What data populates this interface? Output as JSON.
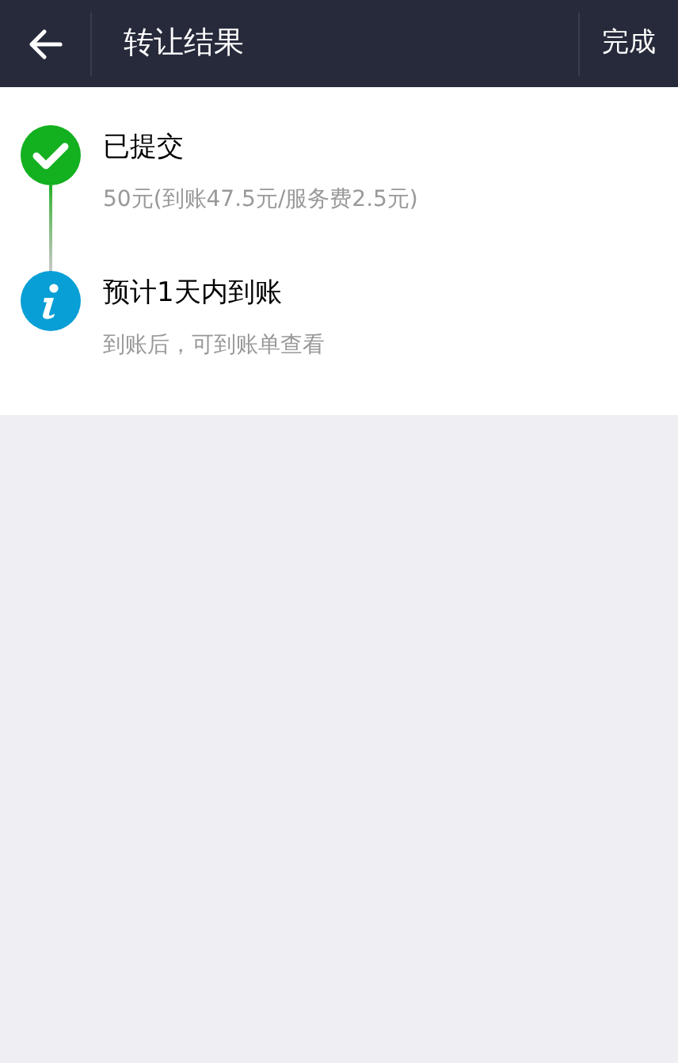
{
  "header": {
    "title": "转让结果",
    "action": "完成"
  },
  "steps": [
    {
      "kind": "done",
      "title": "已提交",
      "detail": "50元(到账47.5元/服务费2.5元)"
    },
    {
      "kind": "info",
      "title": "预计1天内到账",
      "detail": "到账后，可到账单查看"
    }
  ]
}
